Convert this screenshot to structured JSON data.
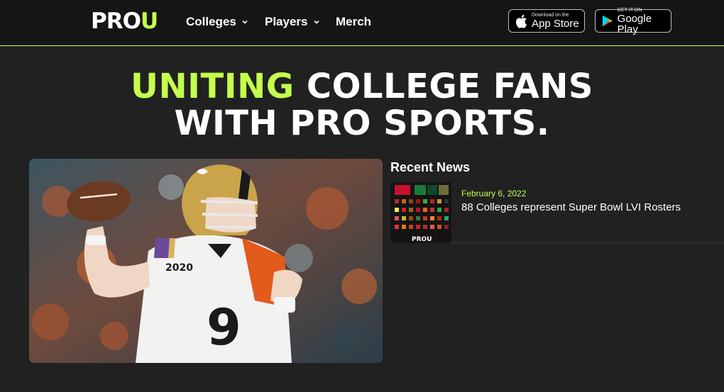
{
  "brand": {
    "logo_main": "PRO",
    "logo_accent": "U",
    "accent_color": "#c4ff4d",
    "background_color": "#212121",
    "header_color": "#151515"
  },
  "nav": {
    "items": [
      {
        "label": "Colleges",
        "has_dropdown": true
      },
      {
        "label": "Players",
        "has_dropdown": true
      },
      {
        "label": "Merch",
        "has_dropdown": false
      }
    ]
  },
  "stores": {
    "apple": {
      "small": "Download on the",
      "big": "App Store",
      "icon": "apple-icon"
    },
    "google": {
      "small": "GET IT ON",
      "big": "Google Play",
      "icon": "google-play-icon"
    }
  },
  "hero": {
    "highlight": "UNITING",
    "line1_rest": " COLLEGE FANS",
    "line2": "WITH PRO SPORTS."
  },
  "feature": {
    "jersey_number": "9",
    "patch_text": "2020"
  },
  "news": {
    "heading": "Recent News",
    "items": [
      {
        "date": "February 6, 2022",
        "title": "88 Colleges represent Super Bowl LVI Rosters",
        "thumb_logo": "PROU"
      }
    ]
  }
}
